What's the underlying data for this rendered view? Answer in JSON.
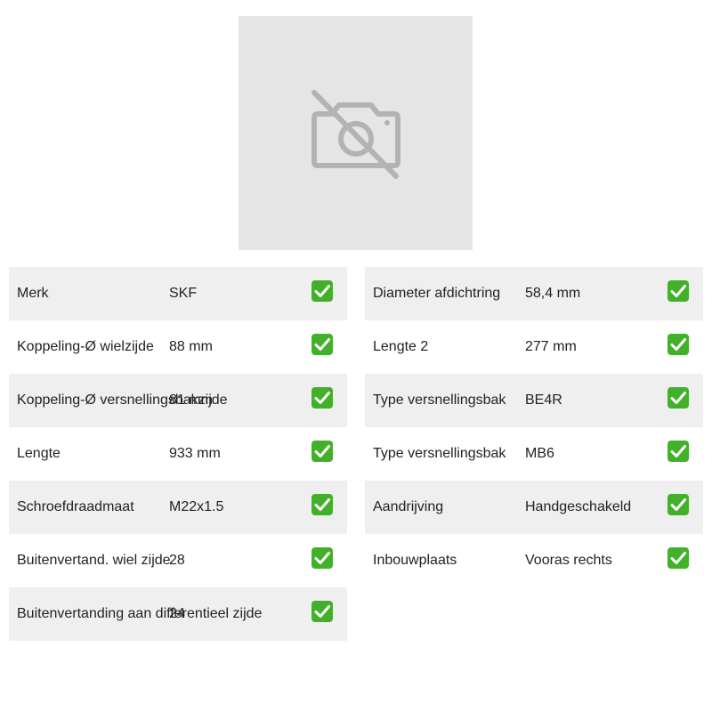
{
  "image": {
    "icon": "no-photo-icon"
  },
  "left_specs": [
    {
      "label": "Merk",
      "value": "SKF"
    },
    {
      "label": "Koppeling-Ø wielzijde",
      "value": "88 mm"
    },
    {
      "label": "Koppeling-Ø versnellingsbakzijde",
      "value": "81 mm"
    },
    {
      "label": "Lengte",
      "value": "933 mm"
    },
    {
      "label": "Schroefdraadmaat",
      "value": "M22x1.5"
    },
    {
      "label": "Buitenvertand. wiel zijde",
      "value": "28"
    },
    {
      "label": "Buitenvertanding aan differentieel zijde",
      "value": "24"
    }
  ],
  "right_specs": [
    {
      "label": "Diameter afdichtring",
      "value": "58,4 mm"
    },
    {
      "label": "Lengte 2",
      "value": "277 mm"
    },
    {
      "label": "Type versnellingsbak",
      "value": "BE4R"
    },
    {
      "label": "Type versnellingsbak",
      "value": "MB6"
    },
    {
      "label": "Aandrijving",
      "value": "Handgeschakeld"
    },
    {
      "label": "Inbouwplaats",
      "value": "Vooras rechts"
    }
  ],
  "colors": {
    "row_shade": "#efefef",
    "check_green": "#43b02a",
    "image_bg": "#e5e5e5"
  },
  "icons": {
    "status": "check-mark-icon"
  }
}
